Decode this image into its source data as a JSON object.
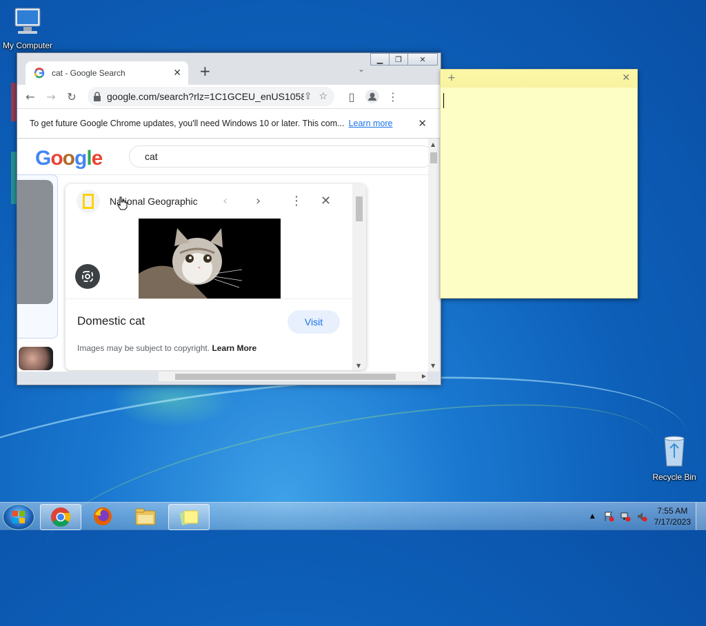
{
  "desktop": {
    "my_computer_label": "My Computer",
    "recycle_bin_label": "Recycle Bin"
  },
  "chrome": {
    "tab_title": "cat - Google Search",
    "url": "google.com/search?rlz=1C1GCEU_enUS1058...",
    "infobar_message": "To get future Google Chrome updates, you'll need Windows 10 or later. This com...",
    "infobar_link": "Learn more",
    "search_query": "cat",
    "panel": {
      "source": "National Geographic",
      "title": "Domestic cat",
      "visit_label": "Visit",
      "copyright_text": "Images may be subject to copyright.",
      "learn_more": "Learn More"
    },
    "google_logo_colors": [
      "#4285f4",
      "#ea4335",
      "#fbbc05",
      "#4285f4",
      "#34a853",
      "#ea4335"
    ]
  },
  "sticky_note": {
    "text": ""
  },
  "taskbar": {
    "time": "7:55 AM",
    "date": "7/17/2023",
    "apps": [
      "chrome-icon",
      "firefox-icon",
      "file-explorer-icon",
      "sticky-notes-icon"
    ]
  }
}
